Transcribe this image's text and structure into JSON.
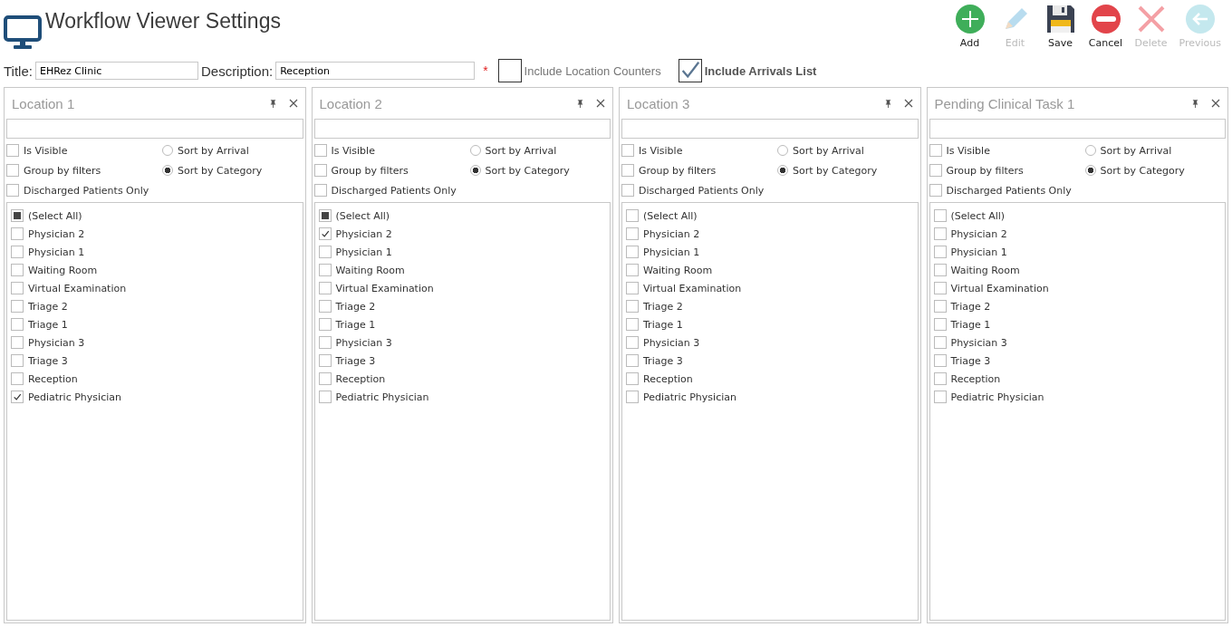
{
  "window": {
    "title": "Workflow Viewer Settings"
  },
  "toolbar": [
    {
      "label": "Add",
      "kind": "add",
      "disabled": false
    },
    {
      "label": "Edit",
      "kind": "edit",
      "disabled": true
    },
    {
      "label": "Save",
      "kind": "save",
      "disabled": false
    },
    {
      "label": "Cancel",
      "kind": "cancel",
      "disabled": false
    },
    {
      "label": "Delete",
      "kind": "delete",
      "disabled": true
    },
    {
      "label": "Previous",
      "kind": "previous",
      "disabled": true
    }
  ],
  "form": {
    "title_label": "Title:",
    "title_value": "EHRez Clinic",
    "description_label": "Description:",
    "description_value": "Reception",
    "required_mark": "*",
    "options": [
      {
        "label": "Include Location Counters",
        "checked": false
      },
      {
        "label": "Include Arrivals List",
        "checked": true
      }
    ]
  },
  "panels": [
    {
      "title": "Location 1",
      "is_visible": {
        "label": "Is Visible",
        "checked": false
      },
      "group_by_filters": {
        "label": "Group by filters",
        "checked": false
      },
      "discharged_only": {
        "label": "Discharged Patients Only",
        "checked": false
      },
      "sort_options": [
        {
          "label": "Sort by Arrival",
          "selected": false
        },
        {
          "label": "Sort by Category",
          "selected": true
        }
      ],
      "select_all": {
        "label": "(Select All)",
        "indeterminate": true
      },
      "items": [
        {
          "label": "Physician 2",
          "checked": false
        },
        {
          "label": "Physician 1",
          "checked": false
        },
        {
          "label": "Waiting Room",
          "checked": false
        },
        {
          "label": "Virtual Examination",
          "checked": false
        },
        {
          "label": "Triage 2",
          "checked": false
        },
        {
          "label": "Triage 1",
          "checked": false
        },
        {
          "label": "Physician 3",
          "checked": false
        },
        {
          "label": "Triage 3",
          "checked": false
        },
        {
          "label": "Reception",
          "checked": false
        },
        {
          "label": "Pediatric Physician",
          "checked": true
        }
      ]
    },
    {
      "title": "Location 2",
      "is_visible": {
        "label": "Is Visible",
        "checked": false
      },
      "group_by_filters": {
        "label": "Group by filters",
        "checked": false
      },
      "discharged_only": {
        "label": "Discharged Patients Only",
        "checked": false
      },
      "sort_options": [
        {
          "label": "Sort by Arrival",
          "selected": false
        },
        {
          "label": "Sort by Category",
          "selected": true
        }
      ],
      "select_all": {
        "label": "(Select All)",
        "indeterminate": true
      },
      "items": [
        {
          "label": "Physician 2",
          "checked": true
        },
        {
          "label": "Physician 1",
          "checked": false
        },
        {
          "label": "Waiting Room",
          "checked": false
        },
        {
          "label": "Virtual Examination",
          "checked": false
        },
        {
          "label": "Triage 2",
          "checked": false
        },
        {
          "label": "Triage 1",
          "checked": false
        },
        {
          "label": "Physician 3",
          "checked": false
        },
        {
          "label": "Triage 3",
          "checked": false
        },
        {
          "label": "Reception",
          "checked": false
        },
        {
          "label": "Pediatric Physician",
          "checked": false
        }
      ]
    },
    {
      "title": "Location 3",
      "is_visible": {
        "label": "Is Visible",
        "checked": false
      },
      "group_by_filters": {
        "label": "Group by filters",
        "checked": false
      },
      "discharged_only": {
        "label": "Discharged Patients Only",
        "checked": false
      },
      "sort_options": [
        {
          "label": "Sort by Arrival",
          "selected": false
        },
        {
          "label": "Sort by Category",
          "selected": true
        }
      ],
      "select_all": {
        "label": "(Select All)",
        "indeterminate": false
      },
      "items": [
        {
          "label": "Physician 2",
          "checked": false
        },
        {
          "label": "Physician 1",
          "checked": false
        },
        {
          "label": "Waiting Room",
          "checked": false
        },
        {
          "label": "Virtual Examination",
          "checked": false
        },
        {
          "label": "Triage 2",
          "checked": false
        },
        {
          "label": "Triage 1",
          "checked": false
        },
        {
          "label": "Physician 3",
          "checked": false
        },
        {
          "label": "Triage 3",
          "checked": false
        },
        {
          "label": "Reception",
          "checked": false
        },
        {
          "label": "Pediatric Physician",
          "checked": false
        }
      ]
    },
    {
      "title": "Pending Clinical Task 1",
      "is_visible": {
        "label": "Is Visible",
        "checked": false
      },
      "group_by_filters": {
        "label": "Group by filters",
        "checked": false
      },
      "discharged_only": {
        "label": "Discharged Patients Only",
        "checked": false
      },
      "sort_options": [
        {
          "label": "Sort by Arrival",
          "selected": false
        },
        {
          "label": "Sort by Category",
          "selected": true
        }
      ],
      "select_all": {
        "label": "(Select All)",
        "indeterminate": false
      },
      "items": [
        {
          "label": "Physician 2",
          "checked": false
        },
        {
          "label": "Physician 1",
          "checked": false
        },
        {
          "label": "Waiting Room",
          "checked": false
        },
        {
          "label": "Virtual Examination",
          "checked": false
        },
        {
          "label": "Triage 2",
          "checked": false
        },
        {
          "label": "Triage 1",
          "checked": false
        },
        {
          "label": "Physician 3",
          "checked": false
        },
        {
          "label": "Triage 3",
          "checked": false
        },
        {
          "label": "Reception",
          "checked": false
        },
        {
          "label": "Pediatric Physician",
          "checked": false
        }
      ]
    }
  ]
}
